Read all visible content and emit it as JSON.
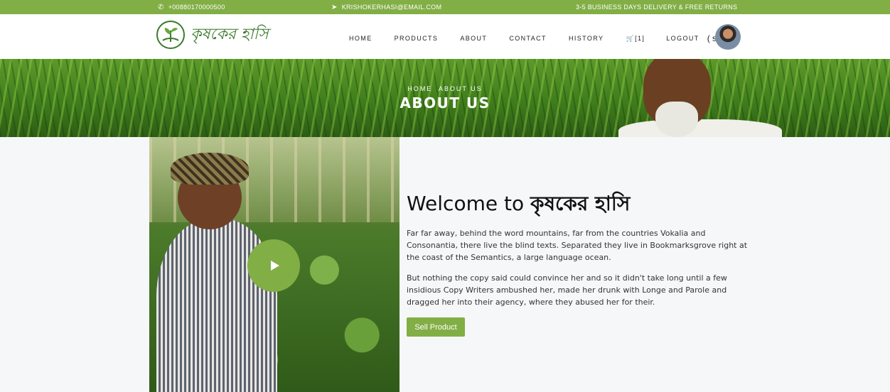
{
  "topbar": {
    "phone": "+00880170000500",
    "email": "KRISHOKERHASI@EMAIL.COM",
    "notice": "3-5 BUSINESS DAYS DELIVERY & FREE RETURNS",
    "phone_icon": "phone-icon",
    "email_icon": "paper-plane-icon"
  },
  "brand": {
    "name": "কৃষকের হাসি",
    "logo_icon": "sprout-logo-icon"
  },
  "nav": {
    "items": [
      "HOME",
      "PRODUCTS",
      "ABOUT",
      "CONTACT",
      "HISTORY"
    ],
    "cart_label": "[1]",
    "cart_icon": "cart-icon",
    "logout": "LOGOUT",
    "user": "( sultan )"
  },
  "hero": {
    "breadcrumb_home": "HOME",
    "breadcrumb_current": "ABOUT US",
    "title": "ABOUT US"
  },
  "about": {
    "welcome_prefix": "Welcome to ",
    "welcome_brand": "কৃষকের হাসি",
    "paragraph1": "Far far away, behind the word mountains, far from the countries Vokalia and Consonantia, there live the blind texts. Separated they live in Bookmarksgrove right at the coast of the Semantics, a large language ocean.",
    "paragraph2": "But nothing the copy said could convince her and so it didn't take long until a few insidious Copy Writers ambushed her, made her drunk with Longe and Parole and dragged her into their agency, where they abused her for their.",
    "sell_button": "Sell Product",
    "play_icon": "play-icon"
  },
  "colors": {
    "accent": "#82ae46",
    "brand_text": "#3b7a2b"
  }
}
